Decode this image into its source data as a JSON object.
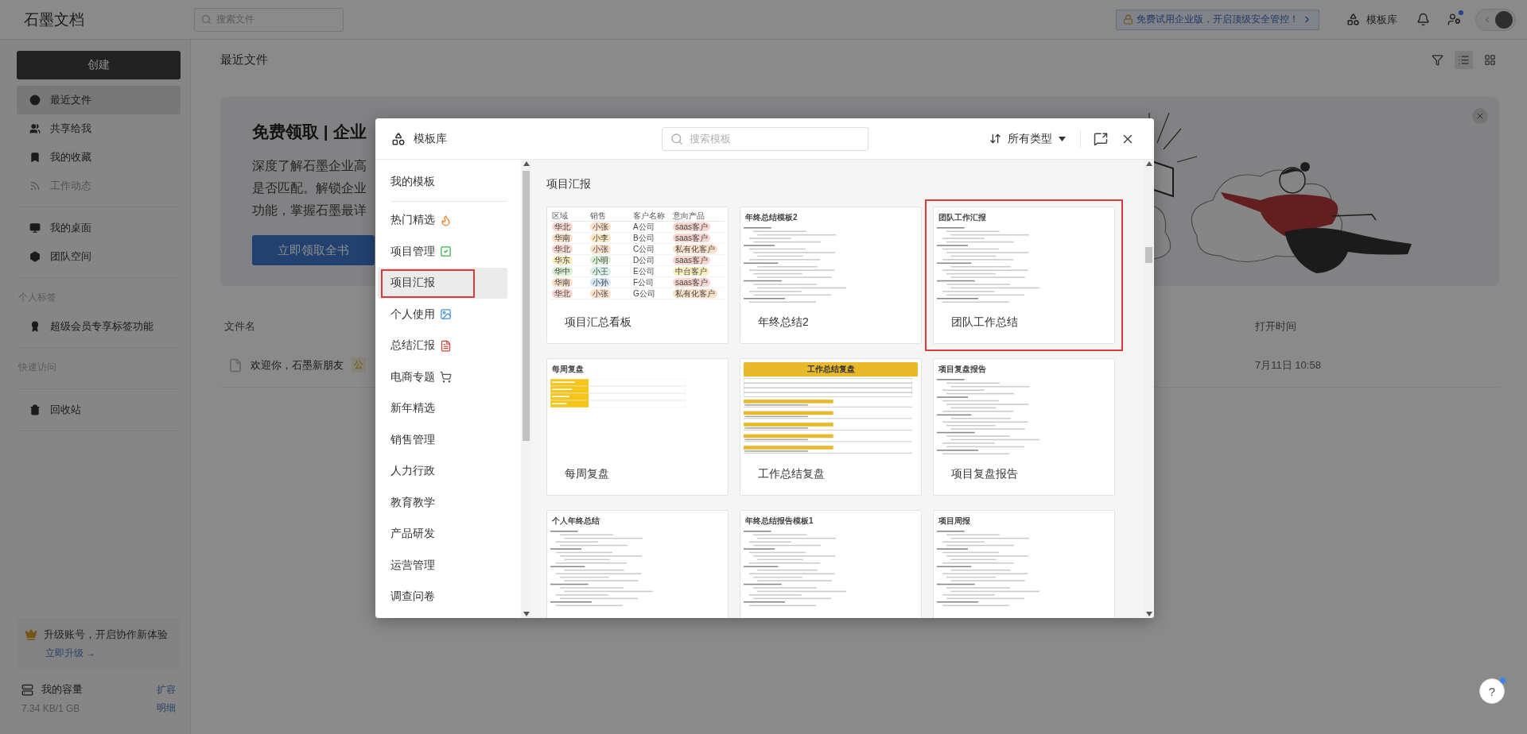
{
  "top_bar": {
    "logo": "石墨文档",
    "search": {
      "placeholder": "搜索文件"
    },
    "promo": "免费试用企业版，开启顶级安全管控！",
    "template_link": "模板库",
    "has_badge": true
  },
  "sidebar": {
    "create_button": "创建",
    "groups": [
      {
        "items": [
          {
            "label": "最近文件",
            "selected": true,
            "disabled": false
          },
          {
            "label": "共享给我",
            "selected": false,
            "disabled": false
          },
          {
            "label": "我的收藏",
            "selected": false,
            "disabled": false
          },
          {
            "label": "工作动态",
            "selected": false,
            "disabled": true
          }
        ]
      },
      {
        "items": [
          {
            "label": "我的桌面",
            "selected": false,
            "disabled": false
          },
          {
            "label": "团队空间",
            "selected": false,
            "disabled": false
          }
        ]
      },
      {
        "heading": "个人标签",
        "items": [
          {
            "label": "超级会员专享标签功能",
            "selected": false,
            "disabled": false
          }
        ]
      },
      {
        "heading": "快速访问"
      },
      {
        "items": [
          {
            "label": "回收站",
            "selected": false,
            "disabled": false
          }
        ]
      }
    ],
    "upgrade": {
      "text": "升级账号，开启协作新体验",
      "link": "立即升级 →"
    },
    "storage": {
      "label": "我的容量",
      "action": "扩容",
      "usage": "7.34 KB/1 GB",
      "detail": "明细"
    }
  },
  "main": {
    "title": "最近文件",
    "views": [
      {
        "kind": "list",
        "selected": true
      },
      {
        "kind": "grid",
        "selected": false
      }
    ],
    "banner": {
      "title": "免费领取 | 企业",
      "lines": [
        "深度了解石墨企业高",
        "是否匹配。解锁企业",
        "功能，掌握石墨最详"
      ],
      "button": "立即领取全书"
    },
    "file_list": {
      "columns": [
        "文件名",
        "打开时间"
      ],
      "rows": [
        {
          "name": "欢迎你，石墨新朋友",
          "tag": "公",
          "opened": "7月11日 10:58"
        }
      ]
    }
  },
  "template_dialog": {
    "title": "模板库",
    "search": {
      "placeholder": "搜索模板"
    },
    "type_filter": "所有类型",
    "pinned": {
      "label": "我的模板",
      "selected": false
    },
    "categories": [
      {
        "label": "热门精选",
        "selected": false,
        "highlighted": false
      },
      {
        "label": "项目管理",
        "selected": false,
        "highlighted": false
      },
      {
        "label": "项目汇报",
        "selected": true,
        "highlighted": true
      },
      {
        "label": "个人使用",
        "selected": false,
        "highlighted": false
      },
      {
        "label": "总结汇报",
        "selected": false,
        "highlighted": false
      },
      {
        "label": "电商专题",
        "selected": false,
        "highlighted": false
      },
      {
        "label": "新年精选",
        "selected": false,
        "highlighted": false
      },
      {
        "label": "销售管理",
        "selected": false,
        "highlighted": false
      },
      {
        "label": "人力行政",
        "selected": false,
        "highlighted": false
      },
      {
        "label": "教育教学",
        "selected": false,
        "highlighted": false
      },
      {
        "label": "产品研发",
        "selected": false,
        "highlighted": false
      },
      {
        "label": "运营管理",
        "selected": false,
        "highlighted": false
      },
      {
        "label": "调查问卷",
        "selected": false,
        "highlighted": false
      }
    ],
    "section_title": "项目汇报",
    "templates": [
      {
        "title": "项目汇总看板",
        "highlighted": false,
        "preview": {
          "kind": "table",
          "columns": [
            "区域",
            "销售",
            "客户名称",
            "意向产品"
          ],
          "rows": [
            [
              {
                "text": "华北",
                "color": "#f7d6cf"
              },
              {
                "text": "小张",
                "color": "#fbe0c8"
              },
              {
                "text": "A公司"
              },
              {
                "text": "saas客户",
                "color": "#f7d6cf"
              }
            ],
            [
              {
                "text": "华南",
                "color": "#fbe0c8"
              },
              {
                "text": "小李",
                "color": "#fde9c4"
              },
              {
                "text": "B公司"
              },
              {
                "text": "saas客户",
                "color": "#f7d6cf"
              }
            ],
            [
              {
                "text": "华北",
                "color": "#f7d6cf"
              },
              {
                "text": "小张",
                "color": "#fbe0c8"
              },
              {
                "text": "C公司"
              },
              {
                "text": "私有化客户",
                "color": "#fbe0c8"
              }
            ],
            [
              {
                "text": "华东",
                "color": "#fbf1c0"
              },
              {
                "text": "小明",
                "color": "#d9f0d3"
              },
              {
                "text": "D公司"
              },
              {
                "text": "saas客户",
                "color": "#f7d6cf"
              }
            ],
            [
              {
                "text": "华中",
                "color": "#d9f0d3"
              },
              {
                "text": "小王",
                "color": "#d6eee6"
              },
              {
                "text": "E公司"
              },
              {
                "text": "中台客户",
                "color": "#fbf1c0"
              }
            ],
            [
              {
                "text": "华南",
                "color": "#fbe0c8"
              },
              {
                "text": "小孙",
                "color": "#d4e6f7"
              },
              {
                "text": "F公司"
              },
              {
                "text": "saas客户",
                "color": "#f7d6cf"
              }
            ],
            [
              {
                "text": "华北",
                "color": "#f7d6cf"
              },
              {
                "text": "小张",
                "color": "#fbe0c8"
              },
              {
                "text": "G公司"
              },
              {
                "text": "私有化客户",
                "color": "#fbe0c8"
              }
            ]
          ]
        }
      },
      {
        "title": "年终总结2",
        "highlighted": false,
        "preview": {
          "kind": "doc",
          "heading": "年终总结模板2"
        }
      },
      {
        "title": "团队工作总结",
        "highlighted": true,
        "preview": {
          "kind": "doc",
          "heading": "团队工作汇报"
        }
      },
      {
        "title": "每周复盘",
        "highlighted": false,
        "preview": {
          "kind": "yellow-grid",
          "heading": "每周复盘"
        }
      },
      {
        "title": "工作总结复盘",
        "highlighted": false,
        "preview": {
          "kind": "yellow-form",
          "heading": "工作总结复盘"
        }
      },
      {
        "title": "项目复盘报告",
        "highlighted": false,
        "preview": {
          "kind": "doc",
          "heading": "项目复盘报告"
        }
      },
      {
        "highlighted": false,
        "preview": {
          "kind": "doc",
          "heading": "个人年终总结"
        }
      },
      {
        "highlighted": false,
        "preview": {
          "kind": "doc",
          "heading": "年终总结报告模板1"
        }
      },
      {
        "highlighted": false,
        "preview": {
          "kind": "doc",
          "heading": "项目周报"
        }
      }
    ]
  },
  "help_button": "?"
}
